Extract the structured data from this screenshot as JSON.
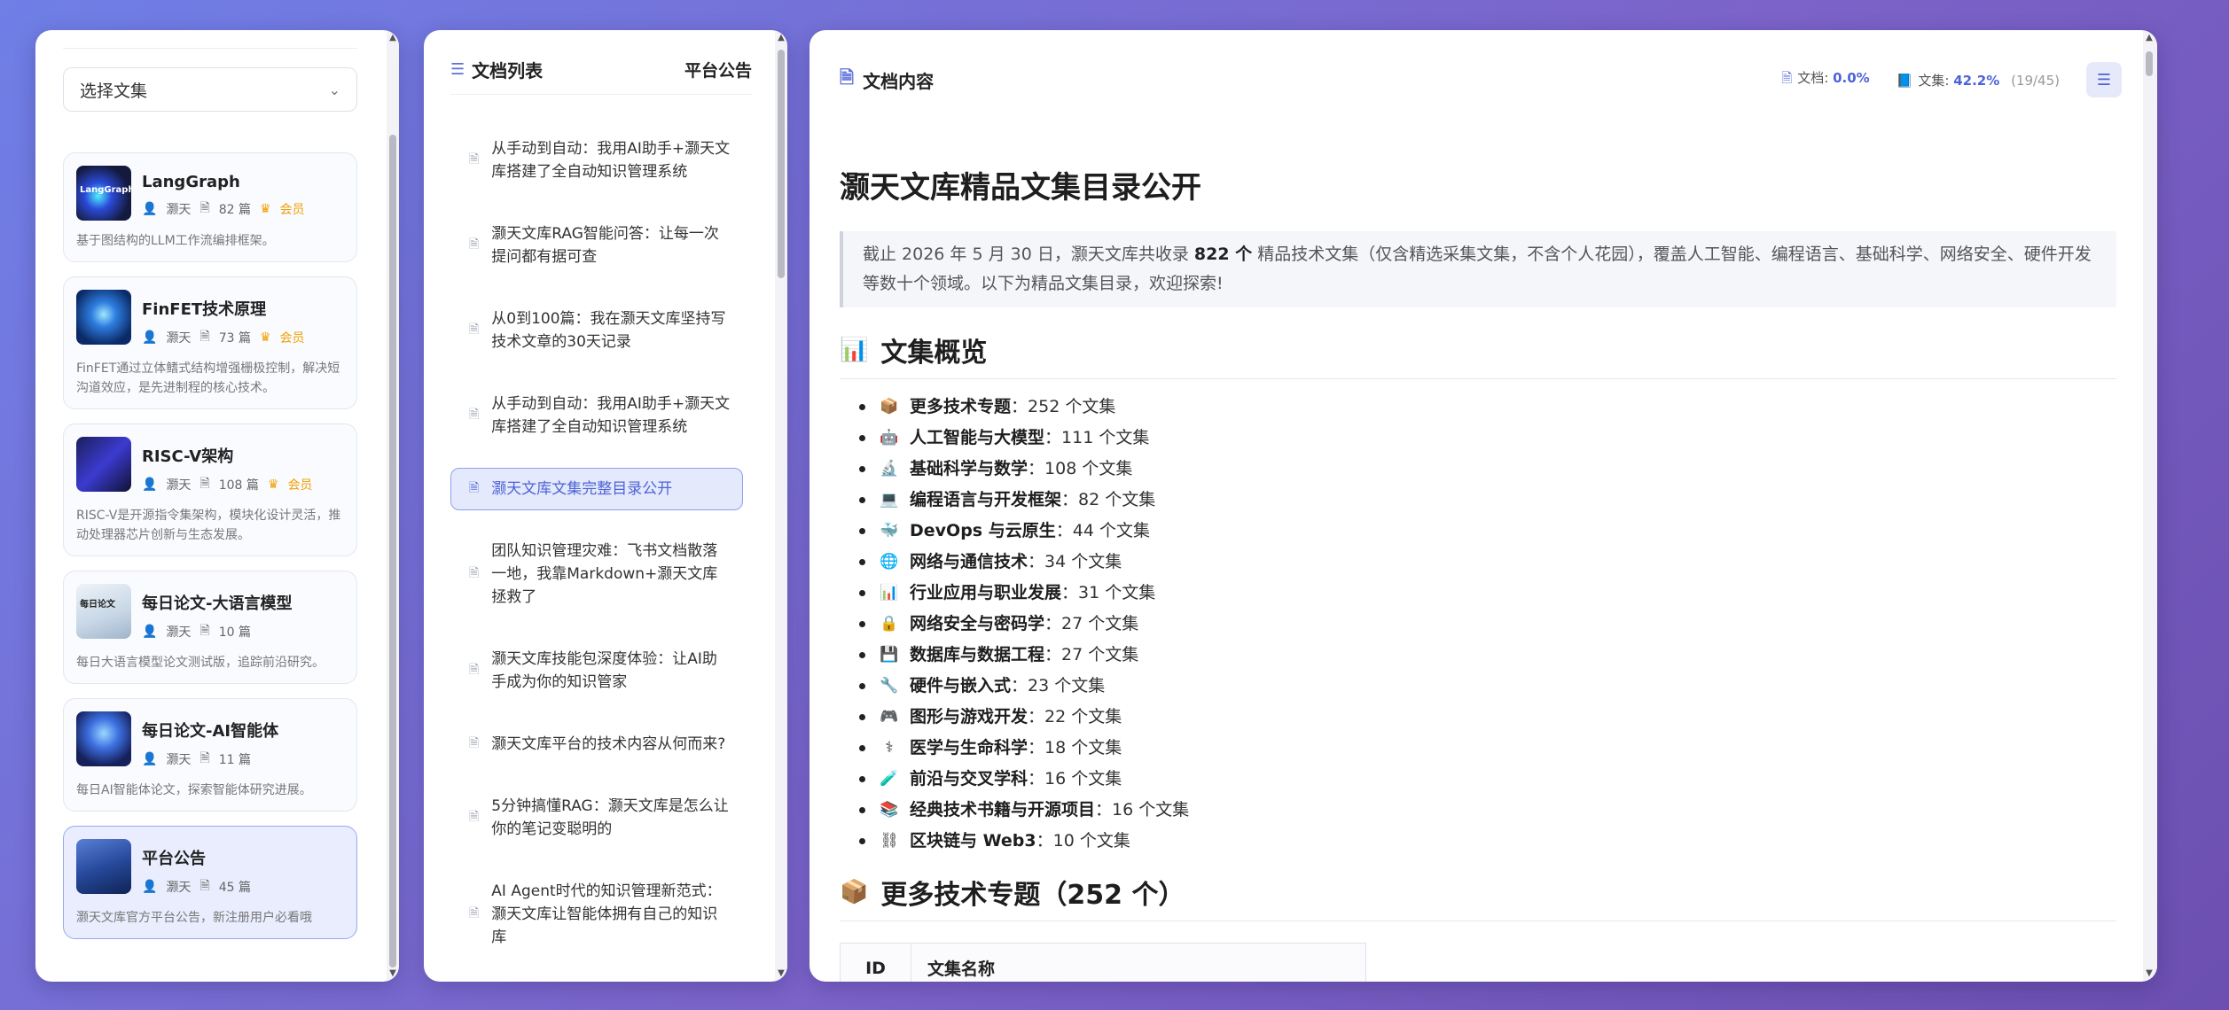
{
  "left_panel": {
    "select_placeholder": "选择文集",
    "cards": [
      {
        "title": "LangGraph",
        "author": "灏天",
        "count": "82 篇",
        "vip": "会员",
        "desc": "基于图结构的LLM工作流编排框架。",
        "thumb_text": "LangGraph"
      },
      {
        "title": "FinFET技术原理",
        "author": "灏天",
        "count": "73 篇",
        "vip": "会员",
        "desc": "FinFET通过立体鳍式结构增强栅极控制，解决短沟道效应，是先进制程的核心技术。",
        "thumb_text": ""
      },
      {
        "title": "RISC-V架构",
        "author": "灏天",
        "count": "108 篇",
        "vip": "会员",
        "desc": "RISC-V是开源指令集架构，模块化设计灵活，推动处理器芯片创新与生态发展。",
        "thumb_text": ""
      },
      {
        "title": "每日论文-大语言模型",
        "author": "灏天",
        "count": "10 篇",
        "vip": "",
        "desc": "每日大语言模型论文测试版，追踪前沿研究。",
        "thumb_text": "每日论文"
      },
      {
        "title": "每日论文-AI智能体",
        "author": "灏天",
        "count": "11 篇",
        "vip": "",
        "desc": "每日AI智能体论文，探索智能体研究进展。",
        "thumb_text": ""
      },
      {
        "title": "平台公告",
        "author": "灏天",
        "count": "45 篇",
        "vip": "",
        "desc": "灏天文库官方平台公告，新注册用户必看哦",
        "thumb_text": ""
      }
    ]
  },
  "mid_panel": {
    "title": "文档列表",
    "notice": "平台公告",
    "docs": [
      "从手动到自动：我用AI助手+灏天文库搭建了全自动知识管理系统",
      "灏天文库RAG智能问答：让每一次提问都有据可查",
      "从0到100篇：我在灏天文库坚持写技术文章的30天记录",
      "从手动到自动：我用AI助手+灏天文库搭建了全自动知识管理系统",
      "灏天文库文集完整目录公开",
      "团队知识管理灾难：飞书文档散落一地，我靠Markdown+灏天文库拯救了",
      "灏天文库技能包深度体验：让AI助手成为你的知识管家",
      "灏天文库平台的技术内容从何而来?",
      "5分钟搞懂RAG：灏天文库是怎么让你的笔记变聪明的",
      "AI Agent时代的知识管理新范式：灏天文库让智能体拥有自己的知识库"
    ]
  },
  "right_panel": {
    "title": "文档内容",
    "doc_label": "文档:",
    "doc_pct": "0.0%",
    "col_label": "文集:",
    "col_pct": "42.2%",
    "col_count": "(19/45)",
    "h1": "灏天文库精品文集目录公开",
    "quote_pre": "截止 2026 年 5 月 30 日，灏天文库共收录 ",
    "quote_bold": "822 个",
    "quote_post": " 精品技术文集（仅含精选采集文集，不含个人花园），覆盖人工智能、编程语言、基础科学、网络安全、硬件开发等数十个领域。以下为精品文集目录，欢迎探索!",
    "overview_title": "文集概览",
    "overview_emoji": "📊",
    "stats": [
      {
        "emoji": "📦",
        "name": "更多技术专题",
        "value": "：252 个文集"
      },
      {
        "emoji": "🤖",
        "name": "人工智能与大模型",
        "value": "：111 个文集"
      },
      {
        "emoji": "🔬",
        "name": "基础科学与数学",
        "value": "：108 个文集"
      },
      {
        "emoji": "💻",
        "name": "编程语言与开发框架",
        "value": "：82 个文集"
      },
      {
        "emoji": "🐳",
        "name": "DevOps 与云原生",
        "value": "：44 个文集"
      },
      {
        "emoji": "🌐",
        "name": "网络与通信技术",
        "value": "：34 个文集"
      },
      {
        "emoji": "📊",
        "name": "行业应用与职业发展",
        "value": "：31 个文集"
      },
      {
        "emoji": "🔒",
        "name": "网络安全与密码学",
        "value": "：27 个文集"
      },
      {
        "emoji": "💾",
        "name": "数据库与数据工程",
        "value": "：27 个文集"
      },
      {
        "emoji": "🔧",
        "name": "硬件与嵌入式",
        "value": "：23 个文集"
      },
      {
        "emoji": "🎮",
        "name": "图形与游戏开发",
        "value": "：22 个文集"
      },
      {
        "emoji": "⚕",
        "name": "医学与生命科学",
        "value": "：18 个文集"
      },
      {
        "emoji": "🧪",
        "name": "前沿与交叉学科",
        "value": "：16 个文集"
      },
      {
        "emoji": "📚",
        "name": "经典技术书籍与开源项目",
        "value": "：16 个文集"
      },
      {
        "emoji": "⛓",
        "name": "区块链与 Web3",
        "value": "：10 个文集"
      }
    ],
    "section2_emoji": "📦",
    "section2_title": "更多技术专题（252 个）",
    "table_headers": [
      "ID",
      "文集名称"
    ]
  }
}
